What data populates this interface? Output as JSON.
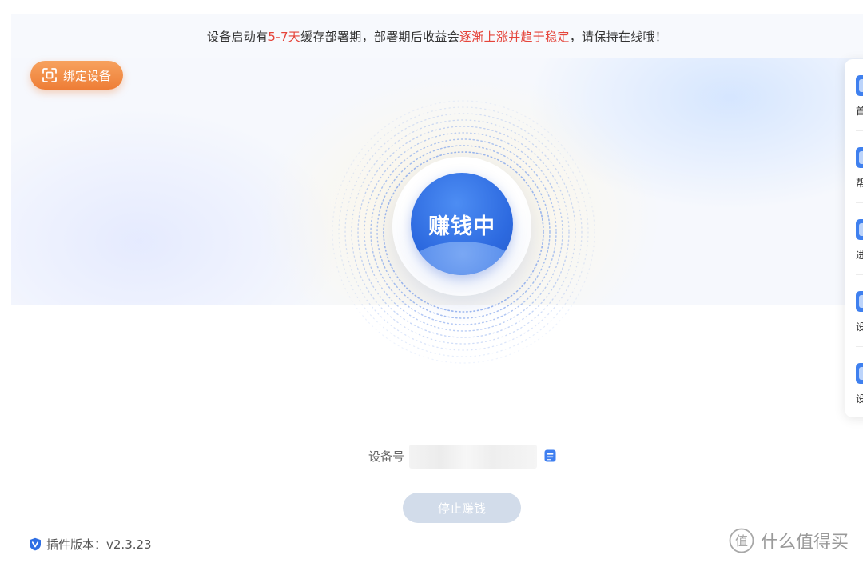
{
  "notice": {
    "part1": "设备启动有",
    "highlight1": "5-7天",
    "part2": "缓存部署期，部署期后收益会",
    "highlight2": "逐渐上涨并趋于稳定",
    "part3": "，请保持在线哦！"
  },
  "bind_button": {
    "label": "绑定设备",
    "icon": "scan-icon"
  },
  "status": {
    "label": "赚钱中"
  },
  "sidebar": {
    "items": [
      {
        "label": "首",
        "icon": "home-icon"
      },
      {
        "label": "帮",
        "icon": "help-doc-icon"
      },
      {
        "label": "进",
        "icon": "progress-icon"
      },
      {
        "label": "设",
        "icon": "device-icon"
      },
      {
        "label": "设",
        "icon": "settings-icon"
      }
    ]
  },
  "device": {
    "label": "设备号",
    "value": "",
    "copy_icon": "copy-icon"
  },
  "stop_button": {
    "label": "停止赚钱"
  },
  "footer": {
    "version_label": "插件版本：v2.3.23",
    "icon": "shield-v-icon"
  },
  "watermark": {
    "text": "什么值得买",
    "icon": "zhi-logo-icon"
  },
  "colors": {
    "accent_blue": "#2d6ae0",
    "highlight_red": "#e5443a",
    "bind_orange": "#ee7d36",
    "stop_disabled": "#d2dcea"
  }
}
